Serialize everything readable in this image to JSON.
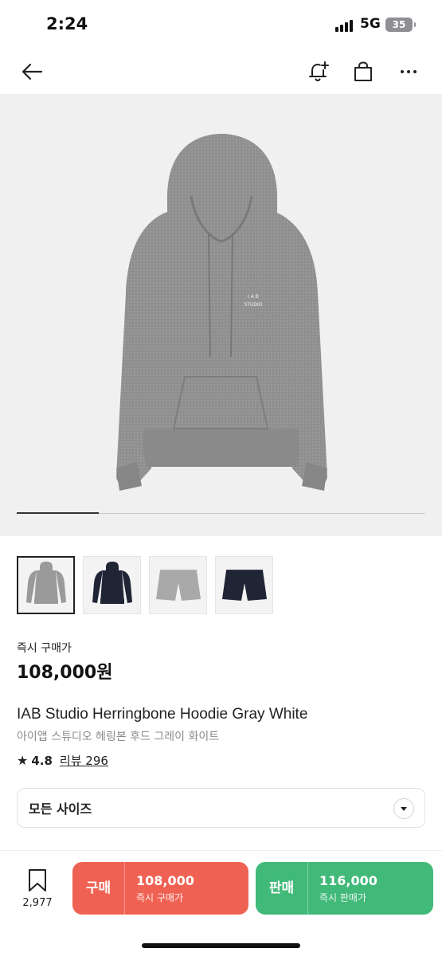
{
  "status_bar": {
    "time": "2:24",
    "network": "5G",
    "battery": "35"
  },
  "nav": {
    "back_icon": "arrow-left-icon",
    "notify_icon": "bell-plus-icon",
    "cart_icon": "shopping-bag-icon",
    "more_icon": "more-horizontal-icon"
  },
  "gallery": {
    "progress": 0.2,
    "thumbnails": [
      {
        "name": "gray-hoodie",
        "color": "#9a9a9a",
        "shape": "hoodie"
      },
      {
        "name": "navy-hoodie",
        "color": "#1f2535",
        "shape": "hoodie"
      },
      {
        "name": "gray-shorts",
        "color": "#a9a9a9",
        "shape": "shorts"
      },
      {
        "name": "navy-shorts",
        "color": "#1f2535",
        "shape": "shorts"
      }
    ]
  },
  "product": {
    "price_label": "즉시 구매가",
    "price": "108,000원",
    "title_en": "IAB Studio Herringbone Hoodie Gray White",
    "title_ko": "아이앱 스튜디오 헤링본 후드 그레이 화이트",
    "rating": "4.8",
    "review_text": "리뷰 296"
  },
  "size_select": {
    "label": "모든 사이즈",
    "icon": "chevron-down-icon"
  },
  "bottom_bar": {
    "wish_count": "2,977",
    "wish_icon": "bookmark-icon",
    "buy": {
      "label": "구매",
      "amount": "108,000",
      "sub": "즉시 구매가",
      "color": "#ef6253"
    },
    "sell": {
      "label": "판매",
      "amount": "116,000",
      "sub": "즉시 판매가",
      "color": "#41b979"
    }
  }
}
